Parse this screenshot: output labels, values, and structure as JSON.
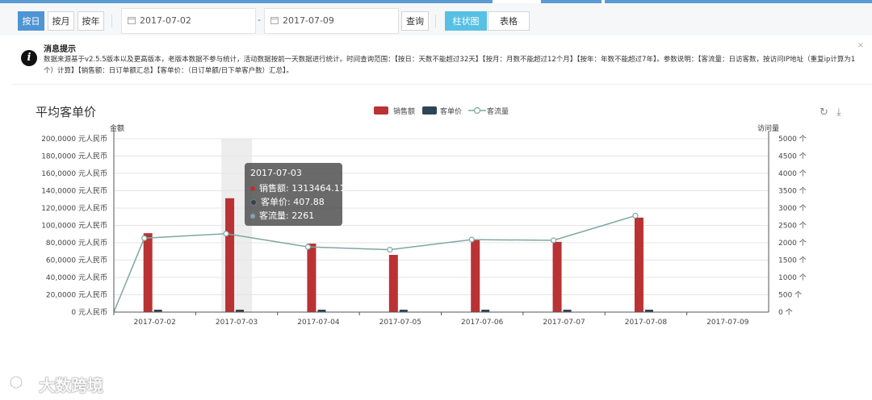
{
  "toolbar": {
    "by_day": "按日",
    "by_month": "按月",
    "by_year": "按年",
    "start_date": "2017-07-02",
    "date_separator": "-",
    "end_date": "2017-07-09",
    "query": "查询",
    "bar_view": "柱状图",
    "table_view": "表格"
  },
  "notice": {
    "title": "消息提示",
    "body": "数据来源基于v2.5.5版本以及更高版本，老版本数据不参与统计，活动数据按前一天数据进行统计。时间查询范围：【按日：天数不能超过32天】【按月：月数不能超过12个月】【按年：年数不能超过7年】。参数说明：【客流量：日访客数，按访问IP地址（重复ip计算为1个）计算】【销售额：日订单额汇总】【客单价：（日订单额/日下单客户数）汇总】。",
    "close": "×"
  },
  "chart": {
    "title": "平均客单价",
    "left_axis_name": "金额",
    "right_axis_name": "访问量",
    "legend": [
      "销售额",
      "客单价",
      "客流量"
    ],
    "colors": {
      "sales": "#b93234",
      "avg_price": "#2f4554",
      "traffic": "#7fa7a4"
    }
  },
  "chart_data": {
    "type": "bar",
    "categories": [
      "2017-07-02",
      "2017-07-03",
      "2017-07-04",
      "2017-07-05",
      "2017-07-06",
      "2017-07-07",
      "2017-07-08",
      "2017-07-09"
    ],
    "series": [
      {
        "name": "销售额",
        "type": "bar",
        "axis": "left",
        "values": [
          910000,
          1313464.11,
          790000,
          660000,
          830000,
          810000,
          1090000,
          0
        ]
      },
      {
        "name": "客单价",
        "type": "bar",
        "axis": "left",
        "values": [
          310,
          407.88,
          340,
          220,
          330,
          320,
          420,
          0
        ]
      },
      {
        "name": "客流量",
        "type": "line",
        "axis": "right",
        "values": [
          2130,
          2261,
          1880,
          1800,
          2090,
          2070,
          2780,
          0
        ]
      }
    ],
    "left_axis": {
      "min": 0,
      "max": 2000000,
      "interval": 200000,
      "tick_labels": [
        "0  元人民币",
        "20,0000  元人民币",
        "40,0000  元人民币",
        "60,0000  元人民币",
        "80,0000  元人民币",
        "100,0000  元人民币",
        "120,0000  元人民币",
        "140,0000  元人民币",
        "160,0000  元人民币",
        "180,0000  元人民币",
        "200,0000  元人民币"
      ]
    },
    "right_axis": {
      "min": 0,
      "max": 5000,
      "interval": 500,
      "tick_labels": [
        "0 个",
        "500 个",
        "1000 个",
        "1500 个",
        "2000 个",
        "2500 个",
        "3000 个",
        "3500 个",
        "4000 个",
        "4500 个",
        "5000 个"
      ]
    },
    "line_start_value": 0,
    "grid": true,
    "legend_position": "top-center"
  },
  "tooltip": {
    "title": "2017-07-03",
    "rows": [
      "销售额: 1313464.11",
      "客单价: 407.88",
      "客流量: 2261"
    ]
  },
  "watermark": "大数跨境"
}
